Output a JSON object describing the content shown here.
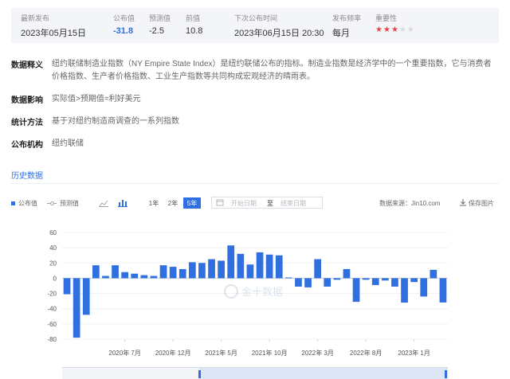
{
  "summary": {
    "latest_label": "最新发布",
    "latest_date": "2023年05月15日",
    "actual_label": "公布值",
    "actual_value": "-31.8",
    "forecast_label": "预测值",
    "forecast_value": "-2.5",
    "previous_label": "前值",
    "previous_value": "10.8",
    "next_label": "下次公布时间",
    "next_time": "2023年06月15日 20:30",
    "freq_label": "发布频率",
    "freq_value": "每月",
    "importance_label": "重要性",
    "importance_stars": 3,
    "importance_total": 5,
    "star_glyph": "★"
  },
  "info": [
    {
      "key": "数据释义",
      "value": "纽约联储制造业指数（NY Empire State Index）是纽约联储公布的指标。制造业指数是经济学中的一个重要指数，它与消费者价格指数、生产者价格指数、工业生产指数等共同构成宏观经济的晴雨表。"
    },
    {
      "key": "数据影响",
      "value": "实际值>预期值=利好美元"
    },
    {
      "key": "统计方法",
      "value": "基于对纽约制造商调查的一系列指数"
    },
    {
      "key": "公布机构",
      "value": "纽约联储"
    }
  ],
  "history_title": "历史数据",
  "toolbar": {
    "legend_actual": "公布值",
    "legend_forecast": "预测值",
    "ranges": [
      "1年",
      "2年",
      "5年"
    ],
    "active_range": "5年",
    "start_placeholder": "开始日期",
    "to_label": "至",
    "end_placeholder": "结束日期",
    "source_text": "数据来源：Jin10.com",
    "save_label": "保存图片",
    "calendar_icon": "calendar-icon",
    "line_icon": "line-chart-icon",
    "bar_icon": "bar-chart-icon",
    "download_icon": "download-icon"
  },
  "watermark": "金十数据",
  "colors": {
    "accent": "#2f6fe0",
    "bar": "#2f6fe0",
    "star_on": "#e5454b",
    "star_off": "#d9d9d9"
  },
  "chart_data": {
    "type": "bar",
    "x": [
      "2020年1月",
      "2020年2月",
      "2020年3月",
      "2020年4月",
      "2020年5月",
      "2020年6月",
      "2020年7月",
      "2020年8月",
      "2020年9月",
      "2020年10月",
      "2020年11月",
      "2020年12月",
      "2021年1月",
      "2021年2月",
      "2021年3月",
      "2021年4月",
      "2021年5月",
      "2021年6月",
      "2021年7月",
      "2021年8月",
      "2021年9月",
      "2021年10月",
      "2021年11月",
      "2021年12月",
      "2022年1月",
      "2022年2月",
      "2022年3月",
      "2022年4月",
      "2022年5月",
      "2022年6月",
      "2022年7月",
      "2022年8月",
      "2022年9月",
      "2022年10月",
      "2022年11月",
      "2022年12月",
      "2023年1月",
      "2023年2月",
      "2023年3月",
      "2023年4月",
      "2023年5月"
    ],
    "series": [
      {
        "values": [
          -21,
          -78,
          -48,
          17,
          3,
          17,
          8,
          6,
          4,
          3,
          17,
          15,
          12,
          21,
          20,
          25,
          23,
          43,
          32,
          18,
          34,
          31,
          30,
          1,
          -11,
          -12,
          25,
          -11,
          -2,
          12,
          -31,
          -2,
          -9,
          -3,
          -11,
          -32,
          -5,
          -24,
          11,
          -31.8
        ]
      }
    ],
    "xticks": [
      "2020年 7月",
      "2020年 12月",
      "2021年 5月",
      "2021年 10月",
      "2022年 3月",
      "2022年 8月",
      "2023年 1月"
    ],
    "yticks": [
      60,
      40,
      20,
      0,
      -20,
      -40,
      -60,
      -80
    ],
    "ylim": [
      -80,
      60
    ],
    "grid": true
  }
}
